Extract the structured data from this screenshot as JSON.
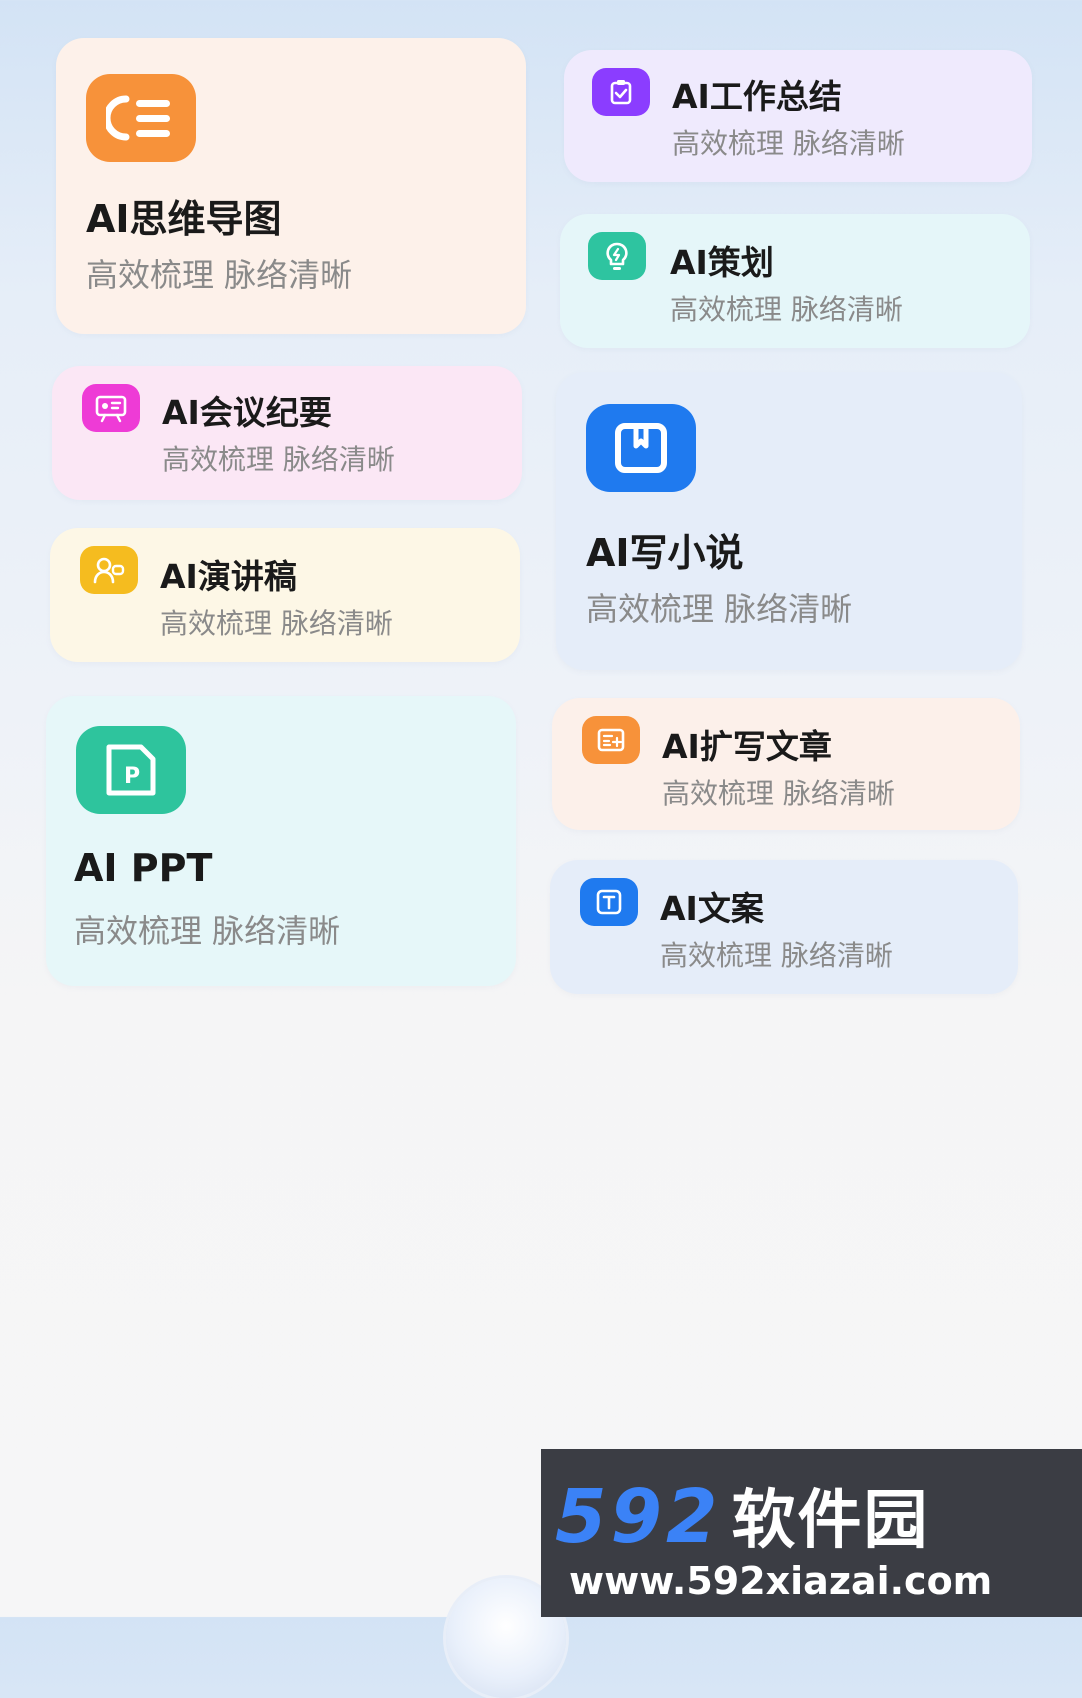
{
  "cards": [
    {
      "id": "mindmap",
      "title": "AI思维导图",
      "subtitle": "高效梳理 脉络清晰",
      "icon": "mindmap-list-icon",
      "color": "#f7923a"
    },
    {
      "id": "work-summary",
      "title": "AI工作总结",
      "subtitle": "高效梳理 脉络清晰",
      "icon": "clipboard-check-icon",
      "color": "#8b3dff"
    },
    {
      "id": "planning",
      "title": "AI策划",
      "subtitle": "高效梳理 脉络清晰",
      "icon": "lightbulb-icon",
      "color": "#2ec4a0"
    },
    {
      "id": "meeting",
      "title": "AI会议纪要",
      "subtitle": "高效梳理 脉络清晰",
      "icon": "meeting-board-icon",
      "color": "#ee3bd6"
    },
    {
      "id": "novel",
      "title": "AI写小说",
      "subtitle": "高效梳理 脉络清晰",
      "icon": "book-icon",
      "color": "#1f7aef"
    },
    {
      "id": "speech",
      "title": "AI演讲稿",
      "subtitle": "高效梳理 脉络清晰",
      "icon": "speaker-icon",
      "color": "#f5bc1f"
    },
    {
      "id": "ppt",
      "title": "AI PPT",
      "subtitle": "高效梳理 脉络清晰",
      "icon": "ppt-file-icon",
      "color": "#2ec49d"
    },
    {
      "id": "expand",
      "title": "AI扩写文章",
      "subtitle": "高效梳理 脉络清晰",
      "icon": "document-expand-icon",
      "color": "#f7923a"
    },
    {
      "id": "copywriting",
      "title": "AI文案",
      "subtitle": "高效梳理 脉络清晰",
      "icon": "text-box-icon",
      "color": "#1f7aef"
    }
  ],
  "watermark": {
    "number": "592",
    "brand": "软件园",
    "url": "www.592xiazai.com"
  }
}
